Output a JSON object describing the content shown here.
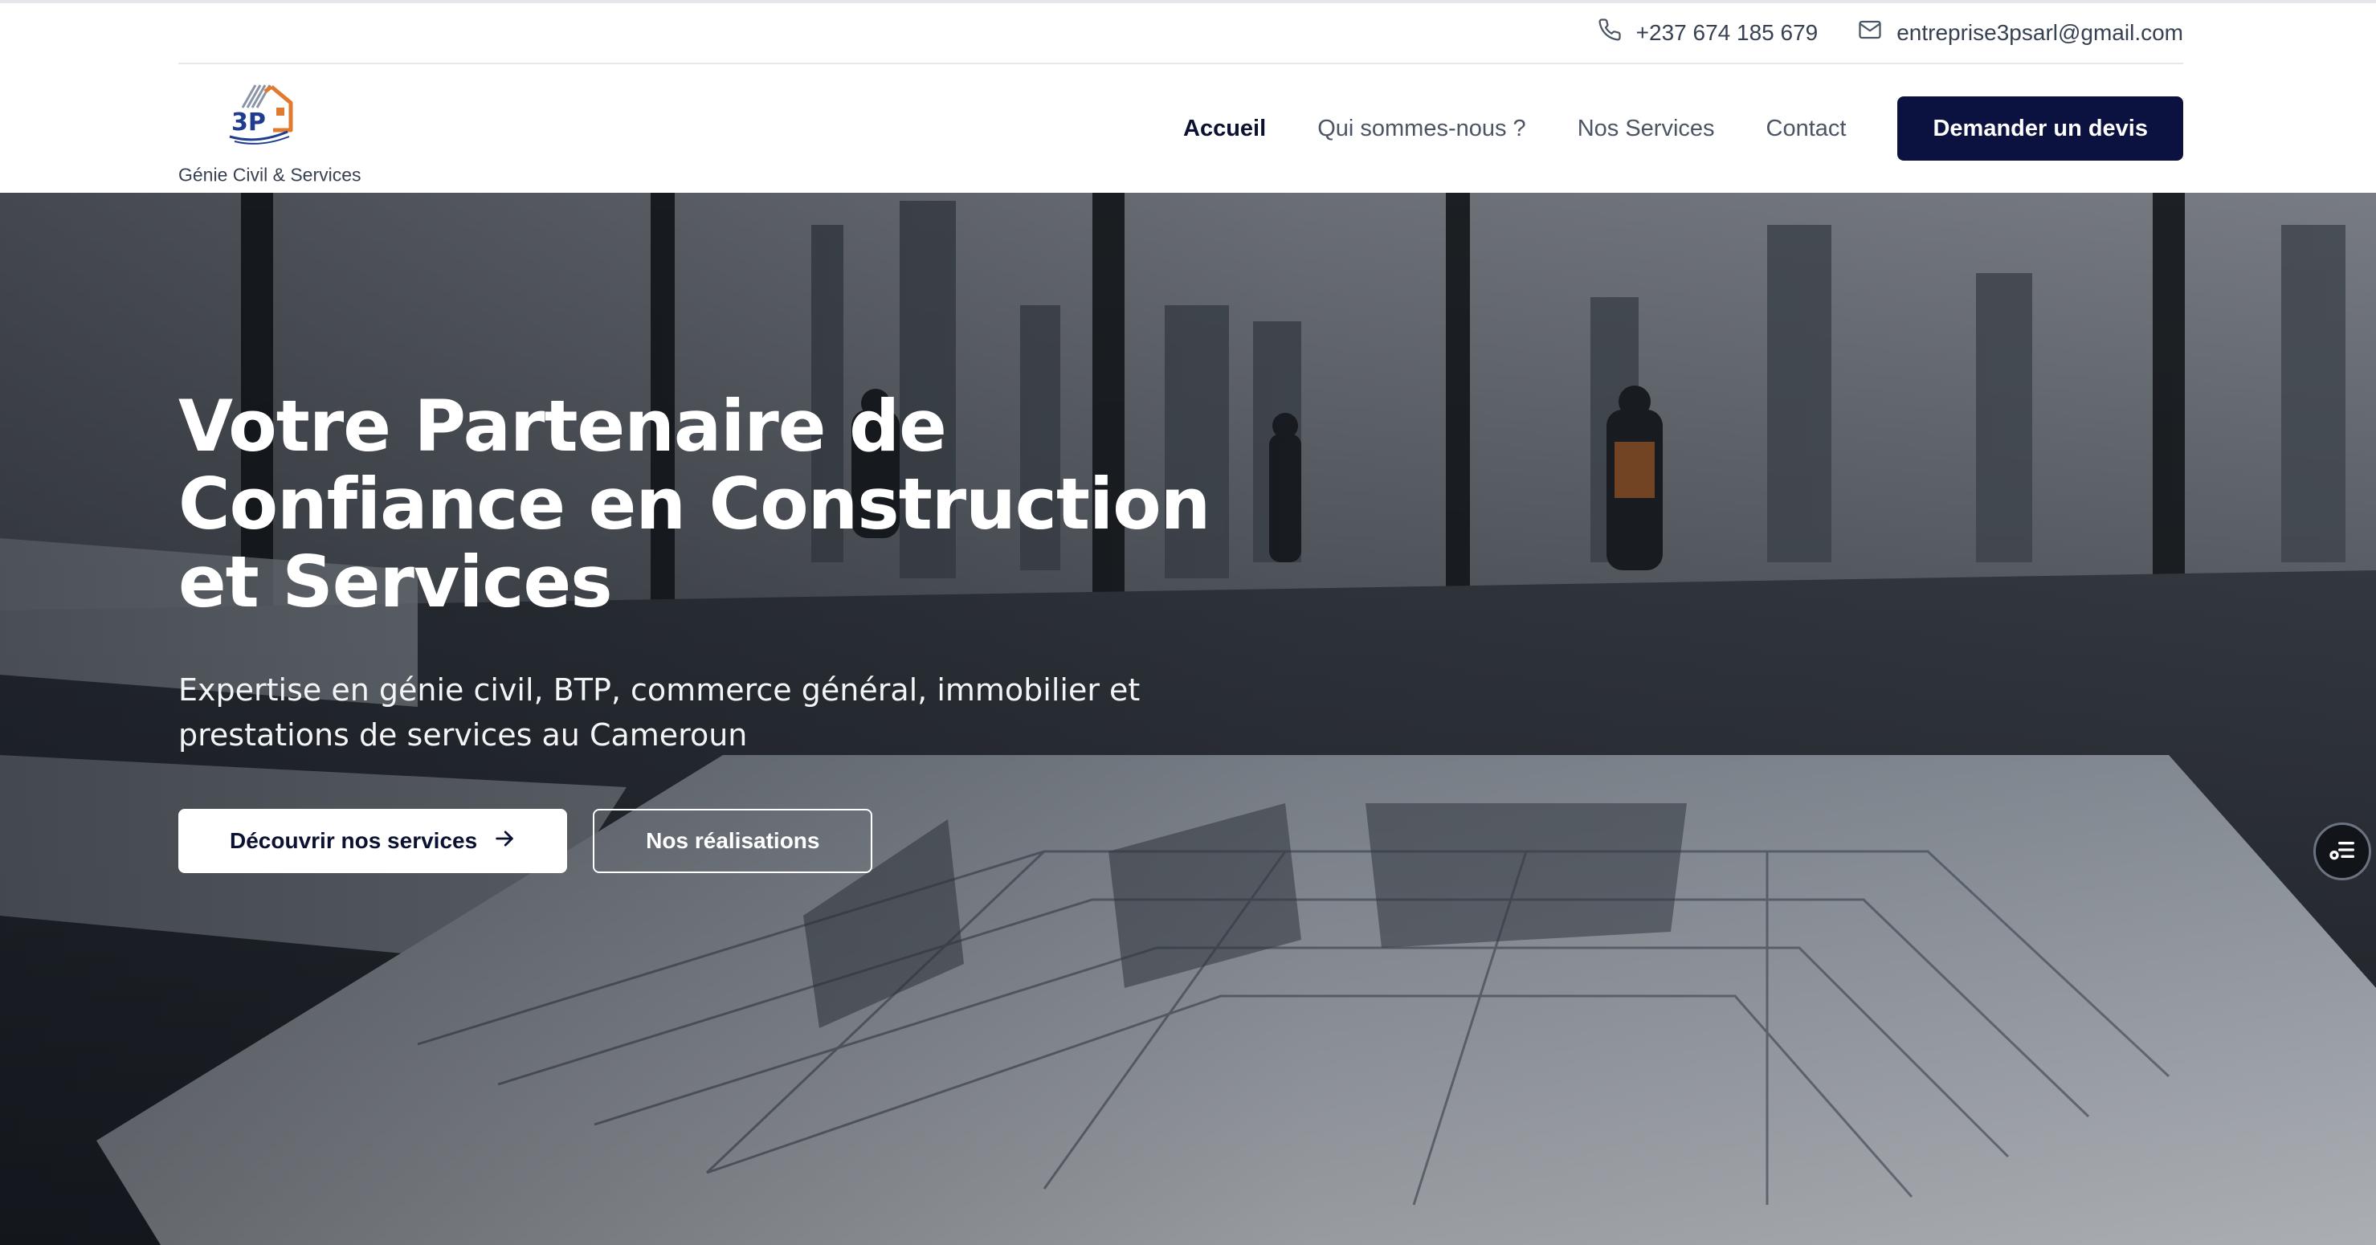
{
  "contact": {
    "phone": "+237 674 185 679",
    "email": "entreprise3psarl@gmail.com"
  },
  "brand": {
    "logo_text": "3P",
    "tagline": "Génie Civil & Services"
  },
  "nav": {
    "items": [
      {
        "label": "Accueil",
        "active": true
      },
      {
        "label": "Qui sommes-nous ?",
        "active": false
      },
      {
        "label": "Nos Services",
        "active": false
      },
      {
        "label": "Contact",
        "active": false
      }
    ],
    "cta_label": "Demander un devis"
  },
  "hero": {
    "title_lines": [
      "Votre Partenaire de",
      "Confiance en Construction",
      "et Services"
    ],
    "subtitle": "Expertise en génie civil, BTP, commerce général, immobilier et prestations de services au Cameroun",
    "primary_button": "Découvrir nos services",
    "secondary_button": "Nos réalisations"
  },
  "icons": {
    "phone": "phone-icon",
    "email": "mail-icon",
    "arrow": "arrow-right-icon",
    "widget": "list-settings-icon"
  },
  "colors": {
    "brand_navy": "#0c1240",
    "logo_orange": "#e07a2e",
    "logo_blue": "#1f3c8f"
  }
}
